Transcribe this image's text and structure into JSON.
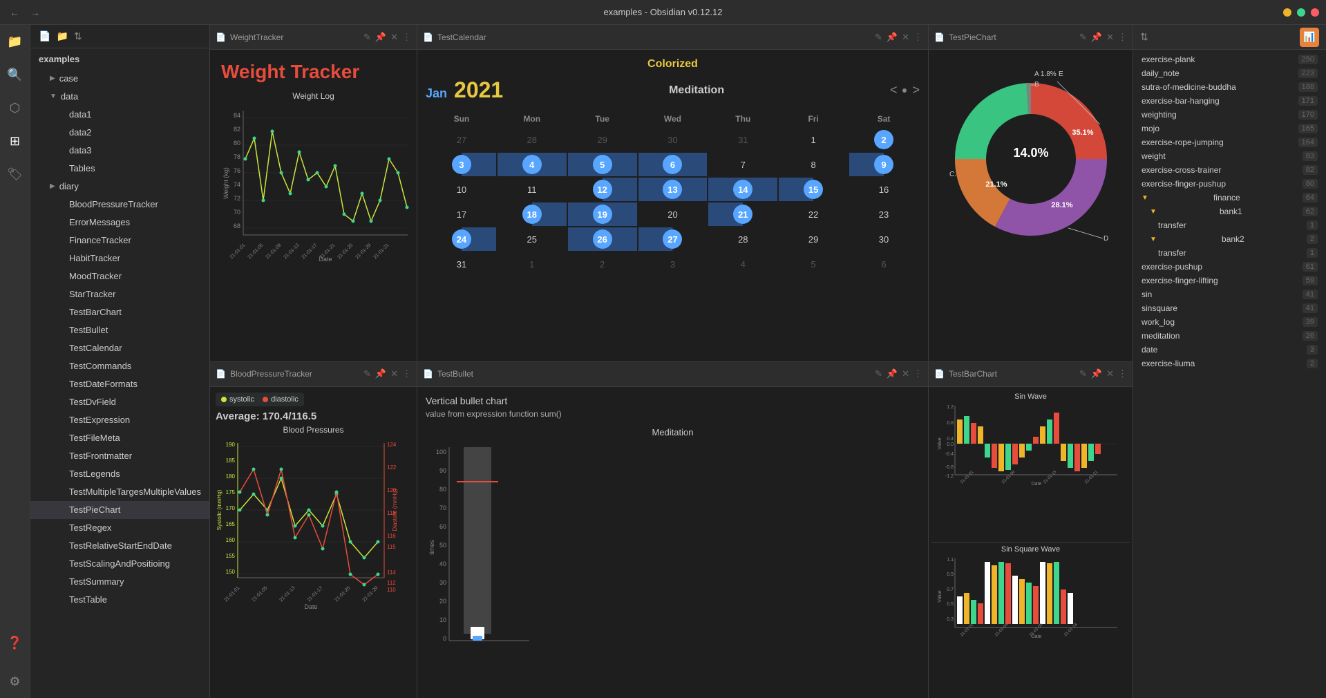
{
  "titlebar": {
    "title": "examples - Obsidian v0.12.12",
    "back": "←",
    "forward": "→"
  },
  "sidebar": {
    "title": "examples",
    "items": [
      {
        "label": "case",
        "indent": 1,
        "arrow": "▶",
        "active": false
      },
      {
        "label": "data",
        "indent": 1,
        "arrow": "▼",
        "active": false
      },
      {
        "label": "data1",
        "indent": 2,
        "arrow": "",
        "active": false
      },
      {
        "label": "data2",
        "indent": 2,
        "arrow": "",
        "active": false
      },
      {
        "label": "data3",
        "indent": 2,
        "arrow": "",
        "active": false
      },
      {
        "label": "Tables",
        "indent": 2,
        "arrow": "",
        "active": false
      },
      {
        "label": "diary",
        "indent": 1,
        "arrow": "▶",
        "active": false
      },
      {
        "label": "BloodPressureTracker",
        "indent": 2,
        "arrow": "",
        "active": false
      },
      {
        "label": "ErrorMessages",
        "indent": 2,
        "arrow": "",
        "active": false
      },
      {
        "label": "FinanceTracker",
        "indent": 2,
        "arrow": "",
        "active": false
      },
      {
        "label": "HabitTracker",
        "indent": 2,
        "arrow": "",
        "active": false
      },
      {
        "label": "MoodTracker",
        "indent": 2,
        "arrow": "",
        "active": false
      },
      {
        "label": "StarTracker",
        "indent": 2,
        "arrow": "",
        "active": false
      },
      {
        "label": "TestBarChart",
        "indent": 2,
        "arrow": "",
        "active": false
      },
      {
        "label": "TestBullet",
        "indent": 2,
        "arrow": "",
        "active": false
      },
      {
        "label": "TestCalendar",
        "indent": 2,
        "arrow": "",
        "active": false
      },
      {
        "label": "TestCommands",
        "indent": 2,
        "arrow": "",
        "active": false
      },
      {
        "label": "TestDateFormats",
        "indent": 2,
        "arrow": "",
        "active": false
      },
      {
        "label": "TestDvField",
        "indent": 2,
        "arrow": "",
        "active": false
      },
      {
        "label": "TestExpression",
        "indent": 2,
        "arrow": "",
        "active": false
      },
      {
        "label": "TestFileMeta",
        "indent": 2,
        "arrow": "",
        "active": false
      },
      {
        "label": "TestFrontmatter",
        "indent": 2,
        "arrow": "",
        "active": false
      },
      {
        "label": "TestLegends",
        "indent": 2,
        "arrow": "",
        "active": false
      },
      {
        "label": "TestMultipleTargesMultipleValues",
        "indent": 2,
        "arrow": "",
        "active": false
      },
      {
        "label": "TestPieChart",
        "indent": 2,
        "arrow": "",
        "active": true
      },
      {
        "label": "TestRegex",
        "indent": 2,
        "arrow": "",
        "active": false
      },
      {
        "label": "TestRelativeStartEndDate",
        "indent": 2,
        "arrow": "",
        "active": false
      },
      {
        "label": "TestScalingAndPositioing",
        "indent": 2,
        "arrow": "",
        "active": false
      },
      {
        "label": "TestSummary",
        "indent": 2,
        "arrow": "",
        "active": false
      },
      {
        "label": "TestTable",
        "indent": 2,
        "arrow": "",
        "active": false
      }
    ]
  },
  "tabs": {
    "col_left": [
      {
        "label": "WeightTracker",
        "active": true,
        "icon": "📄"
      },
      {
        "label": "BloodPressureTracker",
        "active": false,
        "icon": "📄"
      }
    ],
    "col_mid": [
      {
        "label": "TestCalendar",
        "active": true,
        "icon": "📄"
      },
      {
        "label": "TestBullet",
        "active": false,
        "icon": "📄"
      }
    ],
    "col_right": [
      {
        "label": "TestPieChart",
        "active": true,
        "icon": "📄"
      },
      {
        "label": "TestBarChart",
        "active": false,
        "icon": "📄"
      }
    ]
  },
  "weight_tracker": {
    "title": "Weight Tracker",
    "chart_title": "Weight Log",
    "x_label": "Date",
    "y_label": "Weight (kg)"
  },
  "blood_pressure": {
    "legend_systolic": "systolic",
    "legend_diastolic": "diastolic",
    "average": "Average: 170.4/116.5",
    "chart_title": "Blood Pressures",
    "x_label": "Date",
    "y_label_left": "Systolic (mmHg)",
    "y_label_right": "Diastolic (mmHg)"
  },
  "calendar": {
    "colorized_label": "Colorized",
    "month": "Jan",
    "year": "2021",
    "title": "Meditation",
    "days_header": [
      "Sun",
      "Mon",
      "Tue",
      "Wed",
      "Thu",
      "Fri",
      "Sat"
    ],
    "weeks": [
      [
        {
          "day": "27",
          "type": "other"
        },
        {
          "day": "28",
          "type": "other"
        },
        {
          "day": "29",
          "type": "other"
        },
        {
          "day": "30",
          "type": "other"
        },
        {
          "day": "31",
          "type": "other"
        },
        {
          "day": "1",
          "type": "normal"
        },
        {
          "day": "2",
          "type": "active"
        }
      ],
      [
        {
          "day": "3",
          "type": "active"
        },
        {
          "day": "4",
          "type": "active"
        },
        {
          "day": "5",
          "type": "active"
        },
        {
          "day": "6",
          "type": "active"
        },
        {
          "day": "7",
          "type": "normal"
        },
        {
          "day": "8",
          "type": "normal"
        },
        {
          "day": "9",
          "type": "active"
        }
      ],
      [
        {
          "day": "10",
          "type": "normal"
        },
        {
          "day": "11",
          "type": "normal"
        },
        {
          "day": "12",
          "type": "active"
        },
        {
          "day": "13",
          "type": "active"
        },
        {
          "day": "14",
          "type": "active"
        },
        {
          "day": "15",
          "type": "active"
        },
        {
          "day": "16",
          "type": "normal"
        }
      ],
      [
        {
          "day": "17",
          "type": "normal"
        },
        {
          "day": "18",
          "type": "active"
        },
        {
          "day": "19",
          "type": "active"
        },
        {
          "day": "20",
          "type": "normal"
        },
        {
          "day": "21",
          "type": "active"
        },
        {
          "day": "22",
          "type": "normal"
        },
        {
          "day": "23",
          "type": "normal"
        }
      ],
      [
        {
          "day": "24",
          "type": "active"
        },
        {
          "day": "25",
          "type": "normal"
        },
        {
          "day": "26",
          "type": "active"
        },
        {
          "day": "27",
          "type": "active"
        },
        {
          "day": "28",
          "type": "normal"
        },
        {
          "day": "29",
          "type": "normal"
        },
        {
          "day": "30",
          "type": "normal"
        }
      ],
      [
        {
          "day": "31",
          "type": "normal"
        },
        {
          "day": "1",
          "type": "other"
        },
        {
          "day": "2",
          "type": "other"
        },
        {
          "day": "3",
          "type": "other"
        },
        {
          "day": "4",
          "type": "other"
        },
        {
          "day": "5",
          "type": "other"
        },
        {
          "day": "6",
          "type": "other"
        }
      ]
    ]
  },
  "pie_chart": {
    "title": "TestPieChart",
    "labels": {
      "A": "A 1.8%",
      "B": "B",
      "C": "C.",
      "D": "D",
      "E": "E"
    },
    "values": {
      "A": 1.8,
      "B": 3.0,
      "C": 21.1,
      "D": 28.1,
      "E": 35.1,
      "center": 14.0
    },
    "colors": {
      "A": "#808080",
      "B": "#3dd68c",
      "C": "#e8823d",
      "D": "#9b59b6",
      "E": "#e74c3c",
      "center_label": "14.0%"
    }
  },
  "bullet_chart": {
    "title": "TestBullet",
    "heading": "Vertical bullet chart",
    "subheading": "value from expression function sum()",
    "chart_title": "Meditation",
    "y_label": "times"
  },
  "bar_chart": {
    "title": "TestBarChart",
    "sin_wave_title": "Sin Wave",
    "sin_square_title": "Sin Square Wave",
    "x_label": "Date",
    "y_label": "Value"
  },
  "right_panel": {
    "tags": [
      {
        "name": "exercise-plank",
        "count": 250,
        "indent": 0
      },
      {
        "name": "daily_note",
        "count": 223,
        "indent": 0
      },
      {
        "name": "sutra-of-medicine-buddha",
        "count": 188,
        "indent": 0
      },
      {
        "name": "exercise-bar-hanging",
        "count": 171,
        "indent": 0
      },
      {
        "name": "weighting",
        "count": 170,
        "indent": 0
      },
      {
        "name": "mojo",
        "count": 165,
        "indent": 0
      },
      {
        "name": "exercise-rope-jumping",
        "count": 164,
        "indent": 0
      },
      {
        "name": "weight",
        "count": 83,
        "indent": 0
      },
      {
        "name": "exercise-cross-trainer",
        "count": 82,
        "indent": 0
      },
      {
        "name": "exercise-finger-pushup",
        "count": 80,
        "indent": 0
      },
      {
        "name": "finance",
        "count": 64,
        "indent": 0,
        "toggle": "▼"
      },
      {
        "name": "bank1",
        "count": 62,
        "indent": 1,
        "toggle": "▼"
      },
      {
        "name": "transfer",
        "count": 1,
        "indent": 2
      },
      {
        "name": "bank2",
        "count": 2,
        "indent": 1,
        "toggle": "▼"
      },
      {
        "name": "transfer",
        "count": 1,
        "indent": 2
      },
      {
        "name": "exercise-pushup",
        "count": 61,
        "indent": 0
      },
      {
        "name": "exercise-finger-lifting",
        "count": 59,
        "indent": 0
      },
      {
        "name": "sin",
        "count": 41,
        "indent": 0
      },
      {
        "name": "sinsquare",
        "count": 41,
        "indent": 0
      },
      {
        "name": "work_log",
        "count": 39,
        "indent": 0
      },
      {
        "name": "meditation",
        "count": 26,
        "indent": 0
      },
      {
        "name": "date",
        "count": 3,
        "indent": 0
      },
      {
        "name": "exercise-liuma",
        "count": 2,
        "indent": 0
      }
    ]
  }
}
